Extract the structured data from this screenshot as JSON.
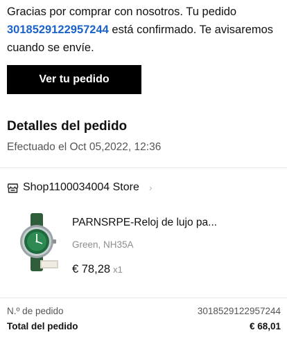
{
  "intro": {
    "before": "Gracias por comprar con nosotros. Tu pedido ",
    "order_number": "3018529122957244",
    "after": " está confirmado. Te avisaremos cuando se envíe."
  },
  "cta": {
    "label": "Ver tu pedido"
  },
  "details": {
    "title": "Detalles del pedido",
    "placed": "Efectuado el Oct 05,2022, 12:36"
  },
  "store": {
    "name": "Shop1100034004 Store",
    "chevron": "›",
    "icon": "store-icon"
  },
  "product": {
    "title": "PARNSRPE-Reloj de lujo pa...",
    "variant": "Green, NH35A",
    "price": "€ 78,28",
    "quantity": "x1",
    "image": "watch-image"
  },
  "summary": {
    "order_no_label": "N.º de pedido",
    "order_no_value": "3018529122957244",
    "total_label": "Total del pedido",
    "total_value": "€ 68,01"
  },
  "colors": {
    "link": "#1b63c9",
    "button_bg": "#000000"
  }
}
